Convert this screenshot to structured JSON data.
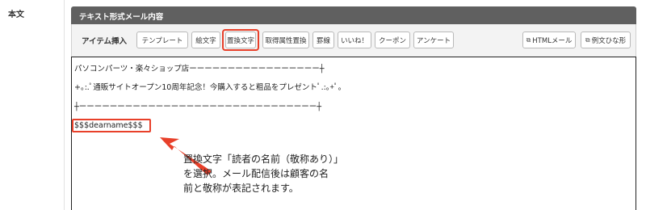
{
  "section_label": "本文",
  "panel_title": "テキスト形式メール内容",
  "toolbar": {
    "label": "アイテム挿入",
    "buttons": {
      "template": "テンプレート",
      "emoji": "絵文字",
      "replace_text": "置換文字",
      "attribute_replace": "取得属性置換",
      "divider": "罫線",
      "like": "いいね！",
      "coupon": "クーポン",
      "survey": "アンケート",
      "html_mail": "HTMLメール",
      "template_example": "例文ひな形"
    }
  },
  "editor": {
    "lines": {
      "line1": "パソコンパーツ・楽々ショップ店ーーーーーーーーーーーーーーーーー┼",
      "line2": "+｡:.ﾟ通販サイトオープン10周年記念！今購入すると粗品をプレゼントﾟ.:｡+ﾟ。",
      "line3": "┼ーーーーーーーーーーーーーーーーーーーーーーーーーーーーーーー┼",
      "token": "$$$dearname$$$"
    }
  },
  "annotation": {
    "line1": "置換文字「読者の名前（敬称あり）」",
    "line2": "を選択。メール配信後は顧客の名",
    "line3": "前と敬称が表記されます。"
  },
  "colors": {
    "header_bg": "#606060",
    "highlight": "#e8402a",
    "arrow": "#e8402a"
  }
}
